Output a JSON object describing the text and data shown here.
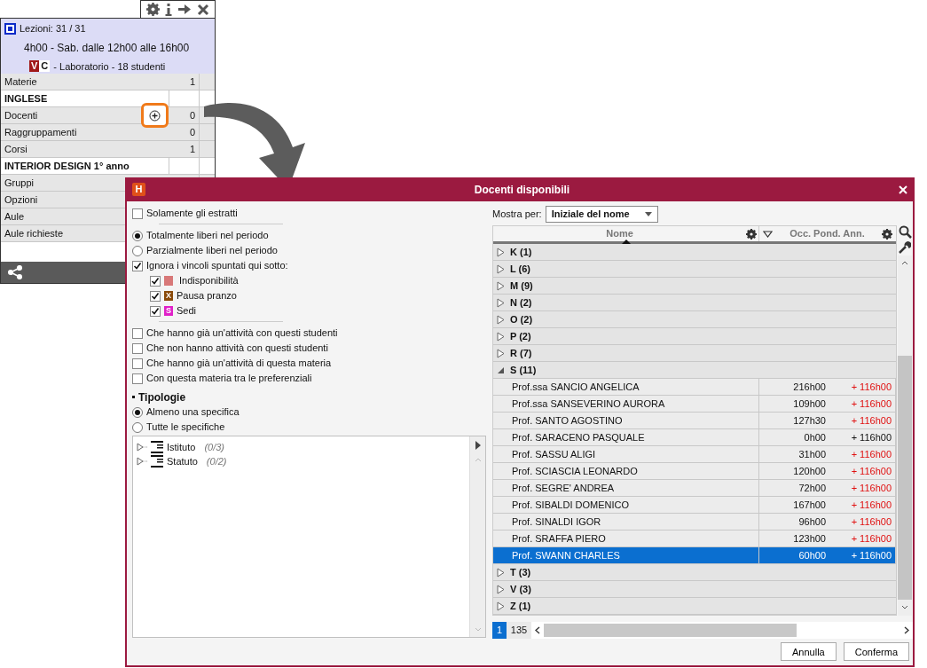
{
  "info_panel": {
    "lesson_count": "Lezioni: 31 / 31",
    "schedule": "4h00 - Sab. dalle 12h00 alle 16h00",
    "tags": [
      {
        "text": "V",
        "color": "#a01818"
      },
      {
        "text": "C",
        "color": "#ffffff"
      }
    ],
    "details": "- Laboratorio - 18 studenti",
    "rows": [
      {
        "kind": "header",
        "label": "Materie",
        "count": "1"
      },
      {
        "kind": "value",
        "label": "INGLESE"
      },
      {
        "kind": "header_add",
        "label": "Docenti",
        "count": "0"
      },
      {
        "kind": "header",
        "label": "Raggruppamenti",
        "count": "0"
      },
      {
        "kind": "header",
        "label": "Corsi",
        "count": "1"
      },
      {
        "kind": "value",
        "label": "INTERIOR DESIGN  1° anno"
      },
      {
        "kind": "header",
        "label": "Gruppi"
      },
      {
        "kind": "header",
        "label": "Opzioni"
      },
      {
        "kind": "header",
        "label": "Aule"
      },
      {
        "kind": "header",
        "label": "Aule richieste"
      }
    ]
  },
  "dialog": {
    "logo": "H",
    "title": "Docenti disponibili",
    "filters": [
      {
        "kind": "checkbox",
        "label": "Solamente gli estratti",
        "checked": false
      },
      {
        "kind": "separator"
      },
      {
        "kind": "radio",
        "label": "Totalmente liberi nel periodo",
        "selected": true
      },
      {
        "kind": "radio",
        "label": "Parzialmente liberi nel periodo",
        "selected": false
      },
      {
        "kind": "checkbox",
        "label": "Ignora i vincoli spuntati qui sotto:",
        "checked": true,
        "children": [
          {
            "kind": "checkbox",
            "label": "Indisponibilità",
            "checked": true,
            "swatch": {
              "color": "#d87878"
            }
          },
          {
            "kind": "checkbox",
            "label": "Pausa pranzo",
            "checked": true,
            "swatch": {
              "letter": "X",
              "color": "#8a4a0a"
            }
          },
          {
            "kind": "checkbox",
            "label": "Sedi",
            "checked": true,
            "swatch": {
              "letter": "S",
              "color": "#e020c8"
            }
          }
        ]
      },
      {
        "kind": "separator"
      },
      {
        "kind": "checkbox",
        "label": "Che hanno già un'attività con questi studenti",
        "checked": false
      },
      {
        "kind": "checkbox",
        "label": "Che non hanno attività con questi studenti",
        "checked": false
      },
      {
        "kind": "checkbox",
        "label": "Che hanno già un'attività di questa materia",
        "checked": false
      },
      {
        "kind": "checkbox",
        "label": "Con questa materia tra le preferenziali",
        "checked": false
      },
      {
        "kind": "heading",
        "label": "Tipologie"
      },
      {
        "kind": "radio",
        "label": "Almeno una specifica",
        "selected": true
      },
      {
        "kind": "radio",
        "label": "Tutte le specifiche",
        "selected": false
      }
    ],
    "tree": [
      {
        "label": "Istituto",
        "count": "(0/3)"
      },
      {
        "label": "Statuto",
        "count": "(0/2)"
      }
    ],
    "show_by": {
      "label": "Mostra per:",
      "value": "Iniziale del nome"
    },
    "table": {
      "columns": [
        "Nome",
        "Occ. Pond. Ann."
      ],
      "groups": [
        {
          "label": "K (1)",
          "expanded": false
        },
        {
          "label": "L (6)",
          "expanded": false
        },
        {
          "label": "M (9)",
          "expanded": false
        },
        {
          "label": "N (2)",
          "expanded": false
        },
        {
          "label": "O (2)",
          "expanded": false
        },
        {
          "label": "P (2)",
          "expanded": false
        },
        {
          "label": "R (7)",
          "expanded": false
        },
        {
          "label": "S (11)",
          "expanded": true,
          "rows": [
            {
              "name": "Prof.ssa SANCIO ANGELICA",
              "hours": "216h00",
              "delta": "+ 116h00",
              "alert": true,
              "selected": false
            },
            {
              "name": "Prof.ssa SANSEVERINO AURORA",
              "hours": "109h00",
              "delta": "+ 116h00",
              "alert": true,
              "selected": false
            },
            {
              "name": "Prof. SANTO AGOSTINO",
              "hours": "127h30",
              "delta": "+ 116h00",
              "alert": true,
              "selected": false
            },
            {
              "name": "Prof. SARACENO PASQUALE",
              "hours": "0h00",
              "delta": "+ 116h00",
              "alert": false,
              "selected": false
            },
            {
              "name": "Prof. SASSU ALIGI",
              "hours": "31h00",
              "delta": "+ 116h00",
              "alert": true,
              "selected": false
            },
            {
              "name": "Prof. SCIASCIA LEONARDO",
              "hours": "120h00",
              "delta": "+ 116h00",
              "alert": true,
              "selected": false
            },
            {
              "name": "Prof. SEGRE' ANDREA",
              "hours": "72h00",
              "delta": "+ 116h00",
              "alert": true,
              "selected": false
            },
            {
              "name": "Prof. SIBALDI DOMENICO",
              "hours": "167h00",
              "delta": "+ 116h00",
              "alert": true,
              "selected": false
            },
            {
              "name": "Prof. SINALDI IGOR",
              "hours": "96h00",
              "delta": "+ 116h00",
              "alert": true,
              "selected": false
            },
            {
              "name": "Prof. SRAFFA PIERO",
              "hours": "123h00",
              "delta": "+ 116h00",
              "alert": true,
              "selected": false
            },
            {
              "name": "Prof. SWANN CHARLES",
              "hours": "60h00",
              "delta": "+ 116h00",
              "alert": false,
              "selected": true
            }
          ]
        },
        {
          "label": "T (3)",
          "expanded": false
        },
        {
          "label": "V (3)",
          "expanded": false
        },
        {
          "label": "Z (1)",
          "expanded": false
        }
      ]
    },
    "pager": {
      "page": "1",
      "total": "135"
    },
    "buttons": [
      "Annulla",
      "Conferma"
    ]
  }
}
